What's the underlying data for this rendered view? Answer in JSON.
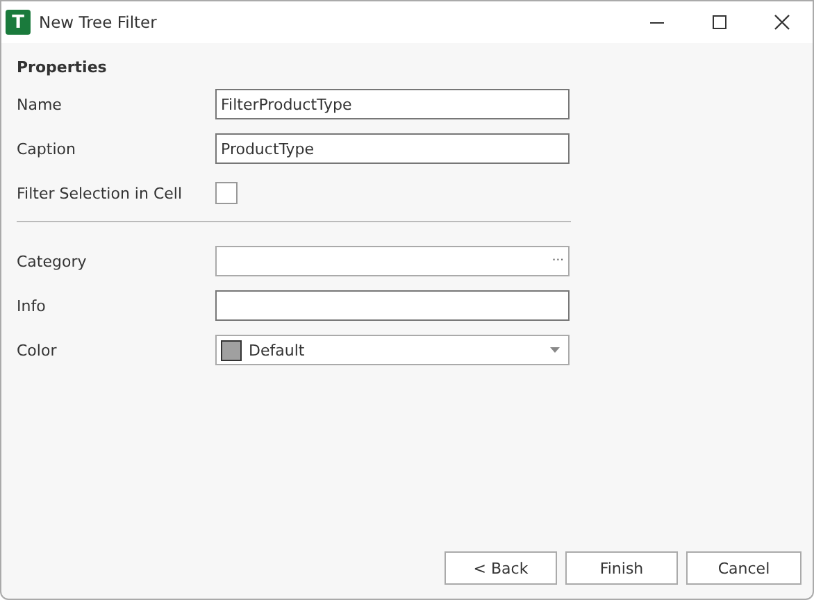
{
  "window": {
    "title": "New Tree Filter",
    "app_icon_letter": "T"
  },
  "section": "Properties",
  "groups": [
    [
      {
        "kind": "text",
        "label": "Name",
        "value": "FilterProductType"
      },
      {
        "kind": "text",
        "label": "Caption",
        "value": "ProductType"
      },
      {
        "kind": "checkbox",
        "label": "Filter Selection in Cell",
        "checked": false
      }
    ],
    [
      {
        "kind": "browse",
        "label": "Category",
        "button": "···"
      },
      {
        "kind": "text",
        "label": "Info"
      },
      {
        "kind": "color",
        "label": "Color",
        "value": "Default"
      }
    ]
  ],
  "buttons": [
    "< Back",
    "Finish",
    "Cancel"
  ]
}
